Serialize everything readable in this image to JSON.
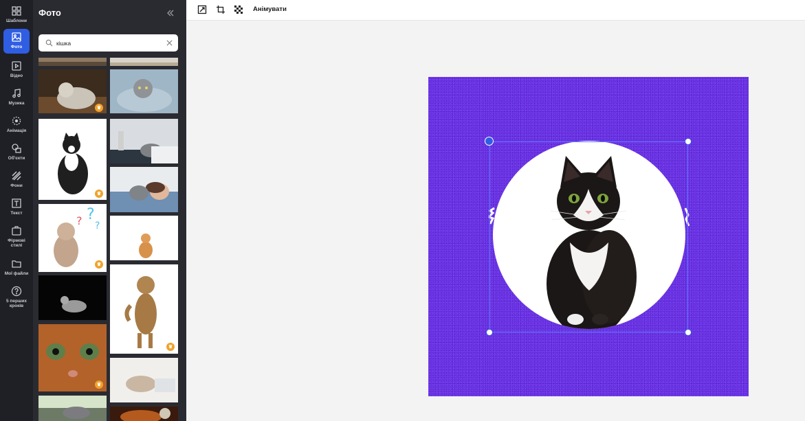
{
  "rail": {
    "items": [
      {
        "label": "Шаблони",
        "icon": "templates-icon",
        "active": false
      },
      {
        "label": "Фото",
        "icon": "photo-icon",
        "active": true
      },
      {
        "label": "Відео",
        "icon": "video-icon",
        "active": false
      },
      {
        "label": "Музика",
        "icon": "music-icon",
        "active": false
      },
      {
        "label": "Анімація",
        "icon": "animation-icon",
        "active": false
      },
      {
        "label": "Об'єкти",
        "icon": "objects-icon",
        "active": false
      },
      {
        "label": "Фони",
        "icon": "backgrounds-icon",
        "active": false
      },
      {
        "label": "Текст",
        "icon": "text-icon",
        "active": false
      },
      {
        "label": "Фірмові\nстилі",
        "icon": "brand-icon",
        "active": false
      },
      {
        "label": "Мої файли",
        "icon": "folder-icon",
        "active": false
      },
      {
        "label": "5 перших\nкроків",
        "icon": "help-icon",
        "active": false
      }
    ]
  },
  "panel": {
    "title": "Фото",
    "search": {
      "value": "кішка",
      "placeholder": ""
    }
  },
  "toolbar": {
    "animate_label": "Анімувати"
  },
  "colors": {
    "accent": "#2f5ee3",
    "artboard_bg": "#6a2fe0",
    "premium_badge": "#f1a22a"
  }
}
